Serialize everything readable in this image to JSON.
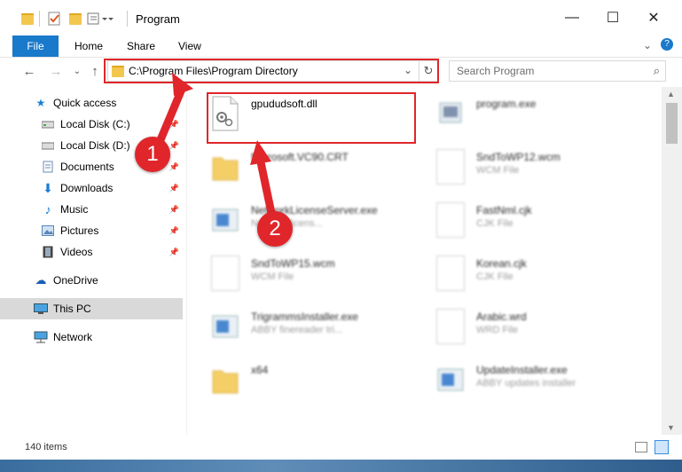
{
  "window": {
    "title": "Program",
    "minimize": "—",
    "maximize": "☐",
    "close": "✕"
  },
  "ribbon": {
    "tabs": [
      "File",
      "Home",
      "Share",
      "View"
    ]
  },
  "address": {
    "path": "C:\\Program Files\\Program Directory",
    "search_placeholder": "Search Program"
  },
  "sidebar": {
    "items": [
      {
        "label": "Quick access",
        "icon": "star-icon",
        "pinned": false
      },
      {
        "label": "Local Disk (C:)",
        "icon": "drive-icon",
        "pinned": true
      },
      {
        "label": "Local Disk (D:)",
        "icon": "drive-icon",
        "pinned": true
      },
      {
        "label": "Documents",
        "icon": "documents-icon",
        "pinned": true
      },
      {
        "label": "Downloads",
        "icon": "download-icon",
        "pinned": true
      },
      {
        "label": "Music",
        "icon": "music-icon",
        "pinned": true
      },
      {
        "label": "Pictures",
        "icon": "pictures-icon",
        "pinned": true
      },
      {
        "label": "Videos",
        "icon": "videos-icon",
        "pinned": true
      },
      {
        "label": "OneDrive",
        "icon": "cloud-icon",
        "pinned": false
      },
      {
        "label": "This PC",
        "icon": "computer-icon",
        "pinned": false,
        "selected": true
      },
      {
        "label": "Network",
        "icon": "network-icon",
        "pinned": false
      }
    ]
  },
  "files": [
    {
      "name": "gpududsoft.dll",
      "type": "",
      "icon": "dll-icon"
    },
    {
      "name": "program.exe",
      "type": "",
      "icon": "exe-icon"
    },
    {
      "name": "Microsoft.VC90.CRT",
      "type": "",
      "icon": "folder-icon"
    },
    {
      "name": "SndToWP12.wcm",
      "type": "WCM File",
      "icon": "document-icon"
    },
    {
      "name": "NetworkLicenseServer.exe",
      "type": "Network licens...",
      "icon": "exe-icon"
    },
    {
      "name": "FastNml.cjk",
      "type": "CJK File",
      "icon": "document-icon"
    },
    {
      "name": "SndToWP15.wcm",
      "type": "WCM File",
      "icon": "document-icon"
    },
    {
      "name": "Korean.cjk",
      "type": "CJK File",
      "icon": "document-icon"
    },
    {
      "name": "TrigrammsInstaller.exe",
      "type": "ABBY finereader tri...",
      "icon": "exe-icon"
    },
    {
      "name": "Arabic.wrd",
      "type": "WRD File",
      "icon": "document-icon"
    },
    {
      "name": "x64",
      "type": "",
      "icon": "folder-icon"
    },
    {
      "name": "UpdateInstaller.exe",
      "type": "ABBY updates installer",
      "icon": "exe-icon"
    }
  ],
  "status": {
    "items_count": "140 items"
  },
  "annotations": {
    "step1": "1",
    "step2": "2",
    "color": "#e0262b"
  }
}
